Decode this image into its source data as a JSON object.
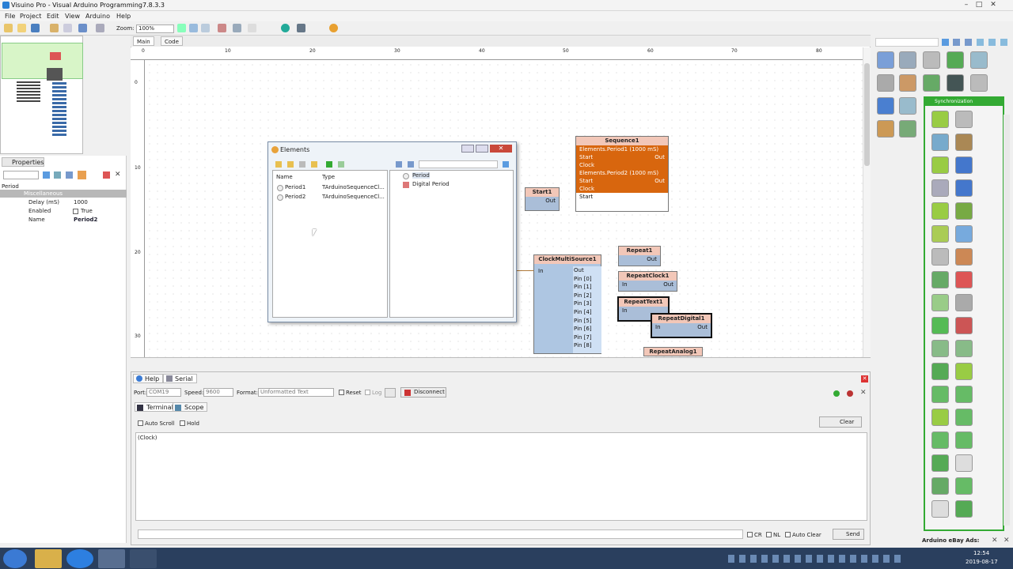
{
  "window": {
    "title": "Visuino Pro - Visual Arduino Programming7.8.3.3",
    "minimize": "–",
    "maximize": "□",
    "close": "✕"
  },
  "menu": [
    "File",
    "Project",
    "Edit",
    "View",
    "Arduino",
    "Help"
  ],
  "toolbar": {
    "zoom_label": "Zoom:",
    "zoom_value": "100%"
  },
  "doc_tabs": [
    "Main",
    "Code"
  ],
  "ruler_h": [
    "0",
    "10",
    "20",
    "30",
    "40",
    "50",
    "60",
    "70",
    "80"
  ],
  "ruler_v": [
    "0",
    "10",
    "20",
    "30"
  ],
  "properties": {
    "tab": "Properties",
    "root": "Period",
    "category": "Miscellaneous",
    "rows": [
      {
        "name": "Delay (mS)",
        "value": "1000"
      },
      {
        "name": "Enabled",
        "value": "True"
      },
      {
        "name": "Name",
        "value": "Period2"
      }
    ]
  },
  "components": {
    "sequence": {
      "title": "Sequence1",
      "lines": [
        "Elements.Period1 (1000 mS)",
        "Start",
        "Clock",
        "Elements.Period2 (1000 mS)",
        "Start",
        "Clock",
        "Start"
      ],
      "out": "Out"
    },
    "start": {
      "title": "Start1",
      "out": "Out"
    },
    "clockmulti": {
      "title": "ClockMultiSource1",
      "in": "In",
      "out": "Out",
      "pins": [
        "Pin [0]",
        "Pin [1]",
        "Pin [2]",
        "Pin [3]",
        "Pin [4]",
        "Pin [5]",
        "Pin [6]",
        "Pin [7]",
        "Pin [8]"
      ]
    },
    "repeat1": {
      "title": "Repeat1",
      "out": "Out"
    },
    "repeatclock": {
      "title": "RepeatClock1",
      "in": "In",
      "out": "Out"
    },
    "repeattext": {
      "title": "RepeatText1",
      "in": "In"
    },
    "repeatdigital": {
      "title": "RepeatDigital1",
      "in": "In",
      "out": "Out"
    },
    "repeatanalog": {
      "title": "RepeatAnalog1"
    }
  },
  "elements_dialog": {
    "title": "Elements",
    "col_name": "Name",
    "col_type": "Type",
    "rows": [
      {
        "name": "Period1",
        "type": "TArduinoSequenceCl..."
      },
      {
        "name": "Period2",
        "type": "TArduinoSequenceCl..."
      }
    ],
    "types": [
      "Period",
      "Digital Period"
    ]
  },
  "bottom": {
    "tabs": [
      "Help",
      "Serial"
    ],
    "port_label": "Port:",
    "port_value": "COM19",
    "speed_label": "Speed:",
    "speed_value": "9600",
    "format_label": "Format:",
    "format_value": "Unformatted Text",
    "reset_label": "Reset",
    "log_label": "Log",
    "disconnect_label": "Disconnect",
    "subtabs": [
      "Terminal",
      "Scope"
    ],
    "autoscroll_label": "Auto Scroll",
    "hold_label": "Hold",
    "clear_label": "Clear",
    "terminal_text": "(Clock)",
    "cr_label": "CR",
    "nl_label": "NL",
    "autoclear_label": "Auto Clear",
    "send_label": "Send"
  },
  "palette": {
    "ads_label": "Arduino eBay Ads:",
    "category": "Synchronization"
  },
  "taskbar": {
    "time": "12:54",
    "date": "2019-08-17"
  }
}
